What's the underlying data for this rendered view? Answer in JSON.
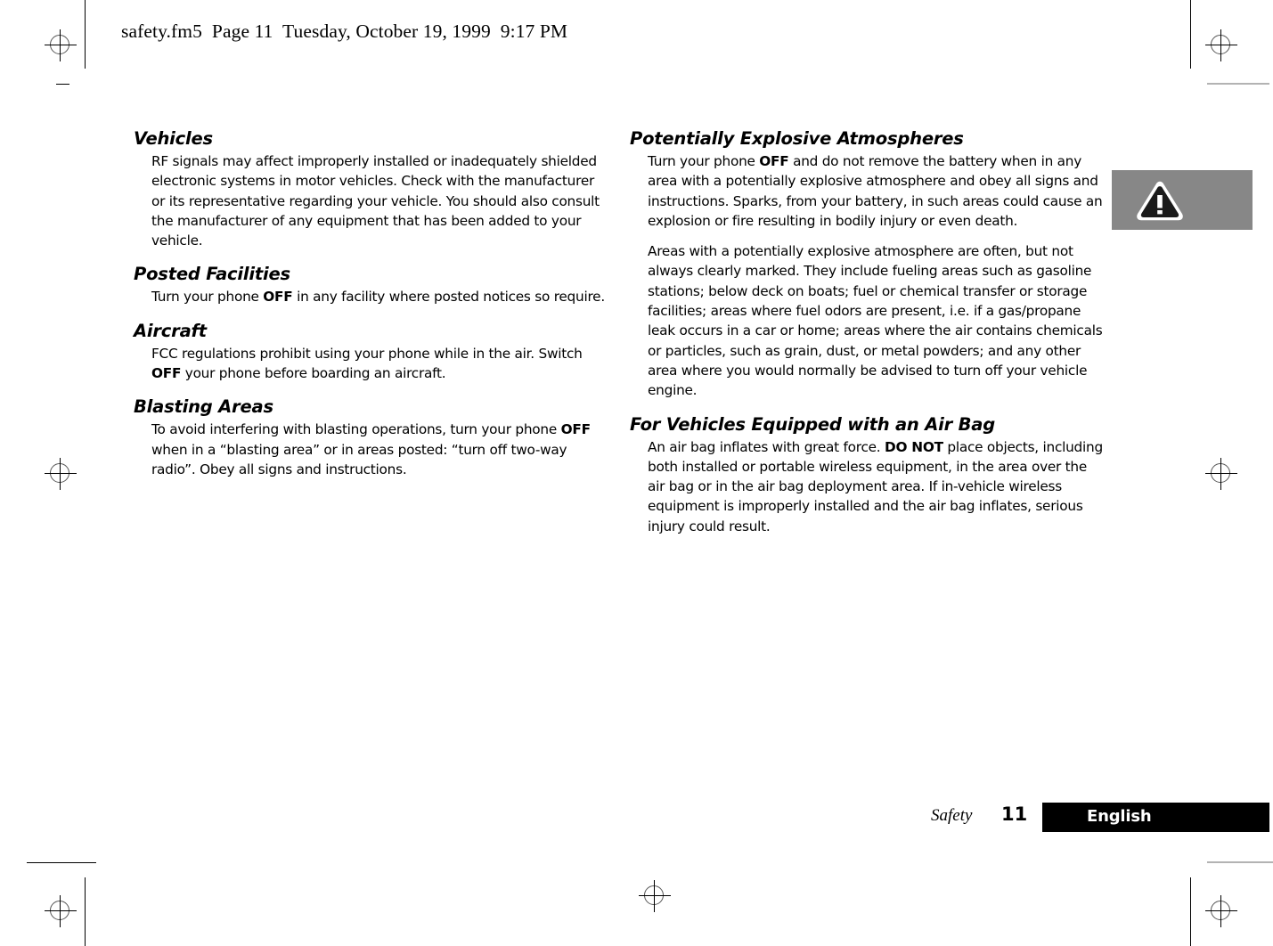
{
  "header": {
    "file_line": "safety.fm5  Page 11  Tuesday, October 19, 1999  9:17 PM"
  },
  "left_column": {
    "sections": [
      {
        "heading": "Vehicles",
        "body": "RF signals may affect improperly installed or inadequately shielded electronic systems in motor vehicles. Check with the manufacturer or its representative regarding your vehicle. You should also consult the manufacturer of any equipment that has been added to your vehicle."
      },
      {
        "heading": "Posted Facilities",
        "body_pre": "Turn your phone ",
        "body_bold": "OFF",
        "body_post": " in any facility where posted notices so require."
      },
      {
        "heading": "Aircraft",
        "body_pre": "FCC regulations prohibit using your phone while in the air. Switch ",
        "body_bold": "OFF",
        "body_post": " your phone before boarding an aircraft."
      },
      {
        "heading": "Blasting Areas",
        "body_pre": "To avoid interfering with blasting operations, turn your phone ",
        "body_bold": "OFF",
        "body_post": " when in a “blasting area” or in areas posted: “turn off two-way radio”. Obey all signs and instructions."
      }
    ]
  },
  "right_column": {
    "sections": [
      {
        "heading": "Potentially Explosive Atmospheres",
        "p1_pre": "Turn your phone ",
        "p1_bold": "OFF",
        "p1_post": " and do not remove the battery when in any area with a potentially explosive atmosphere and obey all signs and instructions. Sparks, from your battery, in such areas could cause an explosion or fire resulting in bodily injury or even death.",
        "p2": "Areas with a potentially explosive atmosphere are often, but not always clearly marked. They include fueling areas such as gasoline stations; below deck on boats; fuel or chemical transfer or storage facilities; areas where fuel odors are present, i.e. if a gas/propane leak occurs in a car or home; areas where the air contains chemicals or particles, such as grain, dust, or metal powders; and any other area where you would normally be advised to turn off your vehicle engine."
      },
      {
        "heading": "For Vehicles Equipped with an Air Bag",
        "p1_pre": "An air bag inflates with great force. ",
        "p1_bold": "DO NOT",
        "p1_post": " place objects, including both installed or portable wireless equipment, in the area over the air bag or in the air bag deployment area. If in-vehicle wireless equipment is improperly installed and the air bag inflates, serious injury could result."
      }
    ]
  },
  "warning_callout": {
    "icon": "warning-triangle-icon",
    "box_color": "#878787",
    "triangle_color": "#1a1a1a"
  },
  "footer": {
    "chapter": "Safety",
    "page_number": "11",
    "language": "English",
    "bar_color": "#000000",
    "language_color": "#ffffff"
  }
}
